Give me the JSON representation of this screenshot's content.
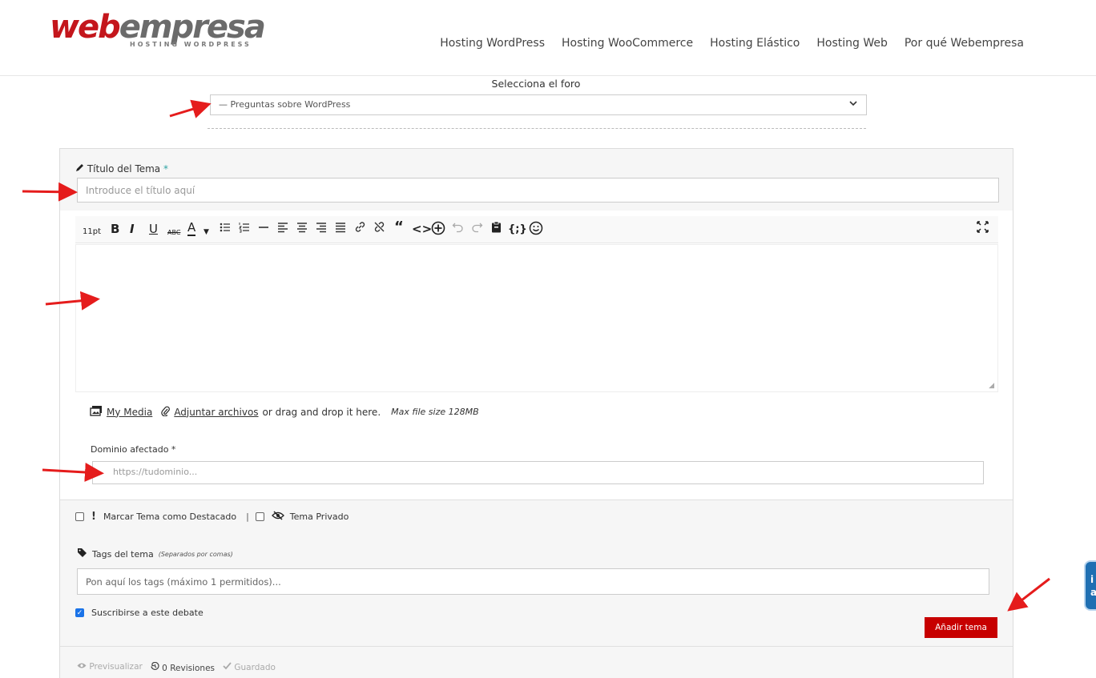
{
  "header": {
    "logo_web": "web",
    "logo_empresa": "empresa",
    "logo_sub": "HOSTING WORDPRESS",
    "nav": [
      {
        "label": "Hosting WordPress"
      },
      {
        "label": "Hosting WooCommerce"
      },
      {
        "label": "Hosting Elástico"
      },
      {
        "label": "Hosting Web"
      },
      {
        "label": "Por qué Webempresa"
      }
    ]
  },
  "forum": {
    "label": "Selecciona el foro",
    "selected": "— Preguntas sobre WordPress"
  },
  "topic": {
    "title_label": "Título del Tema",
    "required_mark": "*",
    "title_placeholder": "Introduce el título aquí"
  },
  "toolbar": {
    "font_size": "11pt",
    "icons": [
      "bold-icon",
      "italic-icon",
      "underline-icon",
      "strikethrough-icon",
      "text-color-icon",
      "bullet-list-icon",
      "numbered-list-icon",
      "horizontal-line-icon",
      "align-left-icon",
      "align-center-icon",
      "align-right-icon",
      "align-justify-icon",
      "link-icon",
      "unlink-icon",
      "blockquote-icon",
      "code-icon",
      "add-media-icon",
      "undo-icon",
      "redo-icon",
      "paste-icon",
      "code-snippet-icon",
      "emoji-icon",
      "fullscreen-icon"
    ]
  },
  "media": {
    "my_media": "My Media",
    "attach": "Adjuntar archivos",
    "drag_text": "or drag and drop it here.",
    "max_size": "Max file size 128MB"
  },
  "domain": {
    "label": "Dominio afectado *",
    "placeholder": "https://tudominio..."
  },
  "options": {
    "featured": "Marcar Tema como Destacado",
    "divider": "|",
    "private": "Tema Privado"
  },
  "tags": {
    "label": "Tags del tema",
    "hint": "(Separados por comas)",
    "placeholder": "Pon aquí los tags (máximo 1 permitidos)..."
  },
  "subscribe": {
    "label": "Suscribirse a este debate",
    "checked": true
  },
  "submit_label": "Añadir tema",
  "footer": {
    "preview": "Previsualizar",
    "revisions": "0 Revisiones",
    "saved": "Guardado"
  },
  "side_widget": {
    "line1": "i",
    "line2": "a"
  },
  "colors": {
    "brand_red": "#c70000",
    "arrow_red": "#e51c1c",
    "checkbox_blue": "#1a73e8"
  }
}
